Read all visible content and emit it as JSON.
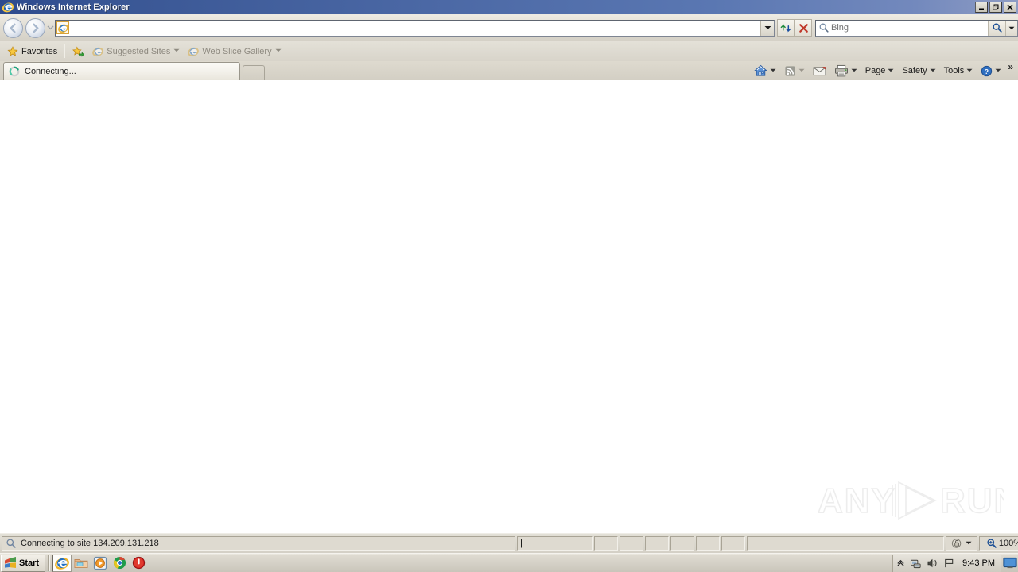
{
  "window": {
    "title": "Windows Internet Explorer",
    "icon": "ie-icon",
    "buttons": {
      "minimize": "_",
      "restore": "❐",
      "close": "✕"
    }
  },
  "toolbar": {
    "back_label": "◀",
    "forward_label": "▶",
    "nav_dropdown": "▼",
    "address": {
      "value": "",
      "placeholder": "",
      "favicon": "ie-icon",
      "dropdown": "▼"
    },
    "refresh_label": "refresh-icon",
    "stop_label": "✕",
    "search": {
      "placeholder": "Bing",
      "value": "",
      "go_label": "search-icon",
      "dropdown": "▼"
    }
  },
  "favorites_bar": {
    "favorites_label": "Favorites",
    "add_to_bar_icon": "add-favorite-icon",
    "items": [
      {
        "label": "Suggested Sites",
        "icon": "ie-icon",
        "dimmed": true,
        "caret": "▼"
      },
      {
        "label": "Web Slice Gallery",
        "icon": "ie-icon",
        "dimmed": true,
        "caret": "▼"
      }
    ]
  },
  "tabs": {
    "items": [
      {
        "title": "Connecting...",
        "icon": "loading-icon",
        "active": true
      }
    ],
    "new_tab_label": ""
  },
  "command_bar": {
    "items": [
      {
        "name": "home",
        "icon": "home-icon",
        "label": "",
        "caret": "▼"
      },
      {
        "name": "feeds",
        "icon": "feed-icon",
        "label": "",
        "caret": "▼"
      },
      {
        "name": "read-mail",
        "icon": "mail-icon",
        "label": "",
        "caret": ""
      },
      {
        "name": "print",
        "icon": "printer-icon",
        "label": "",
        "caret": "▼"
      },
      {
        "name": "page",
        "icon": "",
        "label": "Page",
        "caret": "▼"
      },
      {
        "name": "safety",
        "icon": "",
        "label": "Safety",
        "caret": "▼"
      },
      {
        "name": "tools",
        "icon": "",
        "label": "Tools",
        "caret": "▼"
      },
      {
        "name": "help",
        "icon": "help-icon",
        "label": "",
        "caret": "▼"
      }
    ],
    "overflow_label": "»"
  },
  "page": {
    "content": "",
    "watermark": {
      "text_left": "ANY",
      "text_right": "RUN",
      "logo": "play-triangle-icon"
    }
  },
  "status_bar": {
    "message": "Connecting to site 134.209.131.218",
    "message_icon": "magnifier-icon",
    "security_zone": "",
    "security_icon": "lock-zone-icon",
    "security_caret": "▼",
    "zoom_level": "100%",
    "zoom_icon": "zoom-in-icon",
    "zoom_caret": "▼"
  },
  "taskbar": {
    "start_label": "Start",
    "start_icon": "windows-flag-icon",
    "quick_launch": [
      {
        "name": "internet-explorer",
        "icon": "ie-icon",
        "active": true
      },
      {
        "name": "file-explorer",
        "icon": "folder-icon",
        "active": false
      },
      {
        "name": "media-player",
        "icon": "media-player-icon",
        "active": false
      },
      {
        "name": "google-chrome",
        "icon": "chrome-icon",
        "active": false
      },
      {
        "name": "stop-process",
        "icon": "red-power-icon",
        "active": false
      }
    ],
    "tray": {
      "expand_icon": "«",
      "network_icon": "network-icon",
      "volume_icon": "volume-icon",
      "flag_icon": "flag-icon",
      "time": "9:43 PM",
      "show_desktop_icon": "show-desktop-icon"
    }
  },
  "colors": {
    "titlebar_dark": "#2d4b8e",
    "titlebar_light": "#8e9cc4",
    "chrome_bg": "#d4d0c6",
    "page_bg": "#ffffff",
    "accent": "#3a5795"
  }
}
